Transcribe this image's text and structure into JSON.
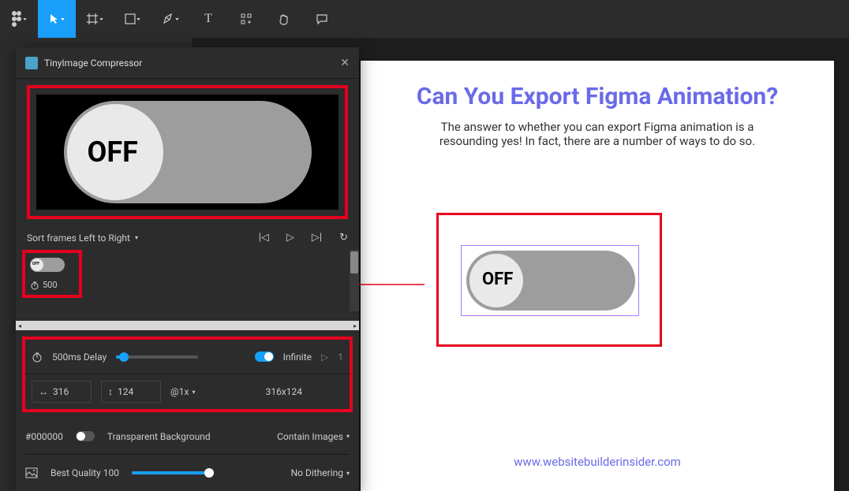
{
  "toolbar": {
    "figma_menu": "F",
    "move_tool": "↖",
    "frame_tool": "#",
    "shape_tool": "□",
    "pen_tool": "✒",
    "text_tool": "T",
    "plugin_tool": "⊞",
    "hand_tool": "✋",
    "comment_tool": "💬"
  },
  "panel": {
    "title": "TinyImage Compressor",
    "close": "✕",
    "preview_label": "OFF",
    "sort_label": "Sort frames Left to Right",
    "playback": {
      "prev": "|◁",
      "play": "▷",
      "next": "▷|",
      "reload": "↻"
    },
    "mini_off": "OFF",
    "mini_timer": "500",
    "delay_label": "500ms Delay",
    "infinite_label": "Infinite",
    "repeat_count": "1",
    "width": "316",
    "height": "124",
    "scale": "@1x",
    "dims": "316x124",
    "bg_hex": "#000000",
    "transparent_label": "Transparent Background",
    "contain_label": "Contain Images",
    "quality_label": "Best Quality 100",
    "dither_label": "No Dithering"
  },
  "page": {
    "heading": "Can You Export Figma Animation?",
    "body": "The answer to whether you can export Figma animation is a resounding yes! In fact, there are a number of ways to do so.",
    "footer": "www.websitebuilderinsider.com",
    "toggle_label": "OFF"
  }
}
